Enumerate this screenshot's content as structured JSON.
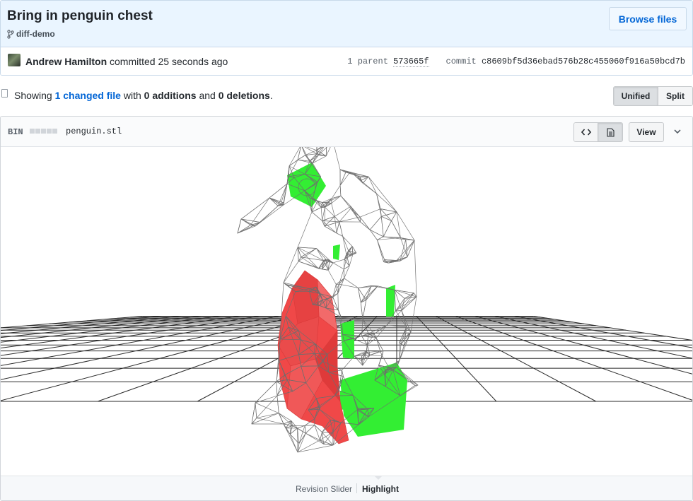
{
  "commit": {
    "title": "Bring in penguin chest",
    "branch": "diff-demo",
    "browse_label": "Browse files",
    "author": "Andrew Hamilton",
    "committed_text": "committed 25 seconds ago",
    "parent_label": "1 parent",
    "parent_sha": "573665f",
    "commit_label": "commit",
    "commit_sha": "c8609bf5d36ebad576b28c455060f916a50bcd7b"
  },
  "summary": {
    "showing": "Showing",
    "changed_files": "1 changed file",
    "with": "with",
    "additions": "0 additions",
    "and": "and",
    "deletions": "0 deletions",
    "period": "."
  },
  "diff_view": {
    "unified_label": "Unified",
    "split_label": "Split",
    "selected": "Unified"
  },
  "file": {
    "badge": "BIN",
    "name": "penguin.stl",
    "source_icon": "code-icon",
    "rendered_icon": "file-text-icon",
    "view_label": "View",
    "menu_icon": "chevron-down-icon"
  },
  "viewer": {
    "revision_slider_label": "Revision Slider",
    "highlight_label": "Highlight",
    "selected_mode": "Highlight",
    "colors": {
      "wireframe": "#6e6e6e",
      "added": "#33ee33",
      "removed": "#f04848",
      "grid": "#2a2a2a"
    }
  }
}
